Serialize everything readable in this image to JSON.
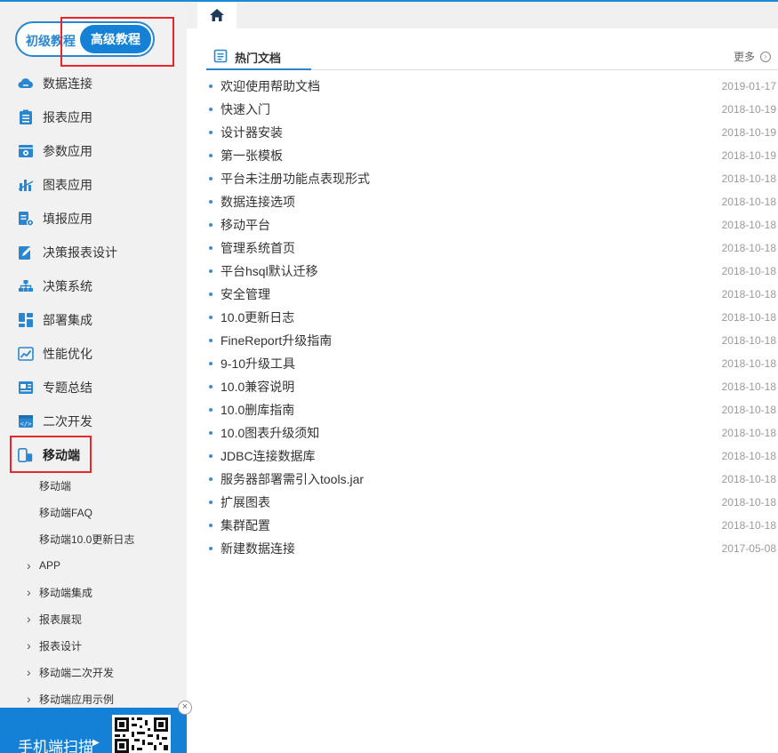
{
  "toggle": {
    "basic": "初级教程",
    "advanced": "高级教程"
  },
  "menu": [
    {
      "label": "数据连接",
      "icon": "cloud-link-icon"
    },
    {
      "label": "报表应用",
      "icon": "report-list-icon"
    },
    {
      "label": "参数应用",
      "icon": "parameter-window-icon"
    },
    {
      "label": "图表应用",
      "icon": "bar-chart-icon"
    },
    {
      "label": "填报应用",
      "icon": "fill-form-icon"
    },
    {
      "label": "决策报表设计",
      "icon": "edit-pencil-icon"
    },
    {
      "label": "决策系统",
      "icon": "org-chart-icon"
    },
    {
      "label": "部署集成",
      "icon": "deploy-blocks-icon"
    },
    {
      "label": "性能优化",
      "icon": "trend-chart-icon"
    },
    {
      "label": "专题总结",
      "icon": "topic-board-icon"
    },
    {
      "label": "二次开发",
      "icon": "code-window-icon"
    },
    {
      "label": "移动端",
      "icon": "mobile-devices-icon"
    }
  ],
  "submenu": [
    {
      "label": "移动端",
      "expandable": false
    },
    {
      "label": "移动端FAQ",
      "expandable": false
    },
    {
      "label": "移动端10.0更新日志",
      "expandable": false
    },
    {
      "label": "APP",
      "expandable": true
    },
    {
      "label": "移动端集成",
      "expandable": true
    },
    {
      "label": "报表展现",
      "expandable": true
    },
    {
      "label": "报表设计",
      "expandable": true
    },
    {
      "label": "移动端二次开发",
      "expandable": true
    },
    {
      "label": "移动端应用示例",
      "expandable": true
    }
  ],
  "qr": {
    "label": "手机端扫描",
    "close": "×"
  },
  "panel": {
    "title": "热门文档",
    "more": "更多"
  },
  "docs": [
    {
      "title": "欢迎使用帮助文档",
      "date": "2019-01-17"
    },
    {
      "title": "快速入门",
      "date": "2018-10-19"
    },
    {
      "title": "设计器安装",
      "date": "2018-10-19"
    },
    {
      "title": "第一张模板",
      "date": "2018-10-19"
    },
    {
      "title": "平台未注册功能点表现形式",
      "date": "2018-10-18"
    },
    {
      "title": "数据连接选项",
      "date": "2018-10-18"
    },
    {
      "title": "移动平台",
      "date": "2018-10-18"
    },
    {
      "title": "管理系统首页",
      "date": "2018-10-18"
    },
    {
      "title": "平台hsql默认迁移",
      "date": "2018-10-18"
    },
    {
      "title": "安全管理",
      "date": "2018-10-18"
    },
    {
      "title": "10.0更新日志",
      "date": "2018-10-18"
    },
    {
      "title": "FineReport升级指南",
      "date": "2018-10-18"
    },
    {
      "title": "9-10升级工具",
      "date": "2018-10-18"
    },
    {
      "title": "10.0兼容说明",
      "date": "2018-10-18"
    },
    {
      "title": "10.0删库指南",
      "date": "2018-10-18"
    },
    {
      "title": "10.0图表升级须知",
      "date": "2018-10-18"
    },
    {
      "title": "JDBC连接数据库",
      "date": "2018-10-18"
    },
    {
      "title": "服务器部署需引入tools.jar",
      "date": "2018-10-18"
    },
    {
      "title": "扩展图表",
      "date": "2018-10-18"
    },
    {
      "title": "集群配置",
      "date": "2018-10-18"
    },
    {
      "title": "新建数据连接",
      "date": "2017-05-08"
    }
  ],
  "colors": {
    "accent": "#1481d6",
    "highlight": "#e8262b",
    "sidebar_bg": "#f1f1f1"
  }
}
